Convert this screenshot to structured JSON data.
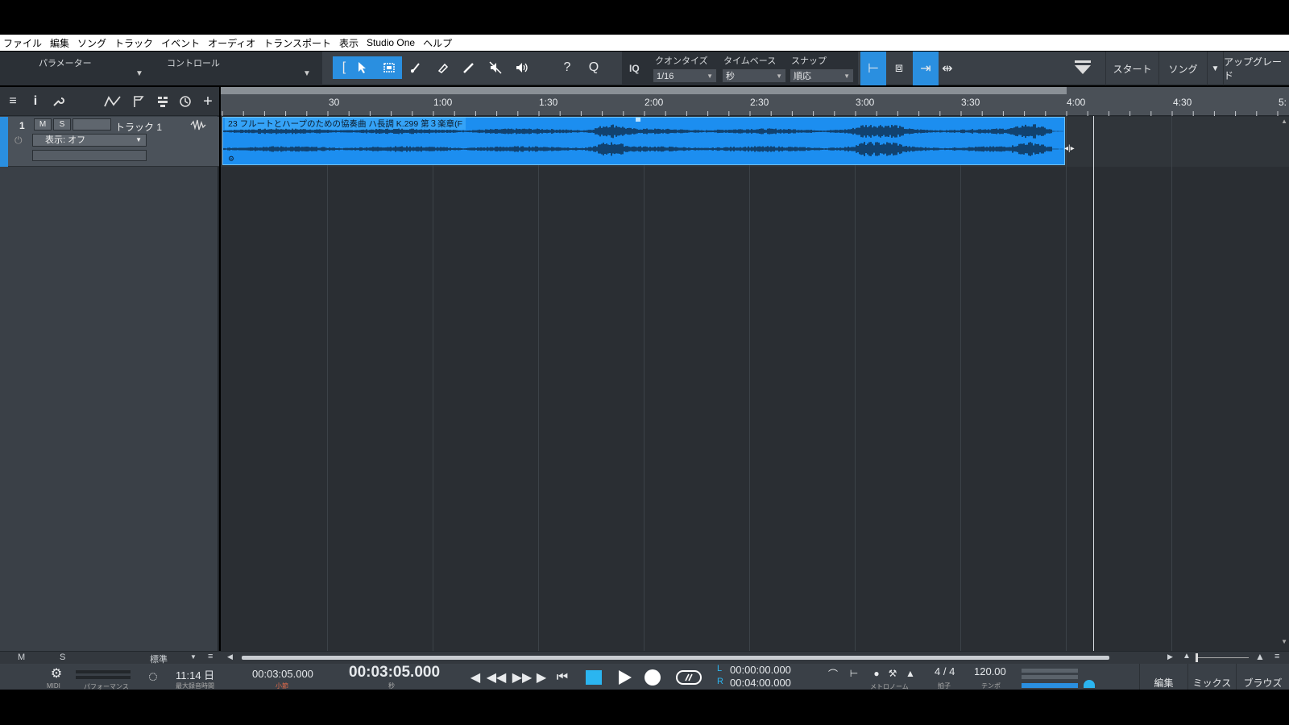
{
  "menu": [
    "ファイル",
    "編集",
    "ソング",
    "トラック",
    "イベント",
    "オーディオ",
    "トランスポート",
    "表示",
    "Studio One",
    "ヘルプ"
  ],
  "toolbar": {
    "parameter_label": "パラメーター",
    "control_label": "コントロール",
    "iq_label": "IQ",
    "quantize_label": "クオンタイズ",
    "quantize_value": "1/16",
    "timebase_label": "タイムベース",
    "timebase_value": "秒",
    "snap_label": "スナップ",
    "snap_value": "順応",
    "start_label": "スタート",
    "song_label": "ソング",
    "upgrade_label": "アップグレード",
    "accent_color": "#2a8fe0"
  },
  "track": {
    "number": "1",
    "mute": "M",
    "solo": "S",
    "name": "トラック 1",
    "display_mode": "表示: オフ"
  },
  "ruler": {
    "labels": [
      "30",
      "1:00",
      "1:30",
      "2:00",
      "2:30",
      "3:00",
      "3:30",
      "4:00",
      "4:30",
      "5:"
    ]
  },
  "event": {
    "title": "23 フルートとハープのための協奏曲 ハ長調 K.299 第３楽章(F",
    "color": "#1c8ef0"
  },
  "bottom_strip": {
    "mute": "M",
    "solo": "S",
    "view_mode": "標準"
  },
  "transport": {
    "time_small": "11:14 日",
    "time_small_sub": "最大録音時間",
    "midi_label": "MIDI",
    "perf_label": "パフォーマンス",
    "position_secondary": "00:03:05.000",
    "position_secondary_sub": "小節",
    "position_primary": "00:03:05.000",
    "position_primary_sub": "秒",
    "loop_left": "00:00:00.000",
    "loop_right": "00:04:00.000",
    "loop_left_tag": "L",
    "loop_right_tag": "R",
    "metronome_label": "メトロノーム",
    "time_signature": "4 / 4",
    "time_signature_sub": "拍子",
    "tempo": "120.00",
    "tempo_sub": "テンポ",
    "tab_edit": "編集",
    "tab_mix": "ミックス",
    "tab_browse": "ブラウズ"
  }
}
